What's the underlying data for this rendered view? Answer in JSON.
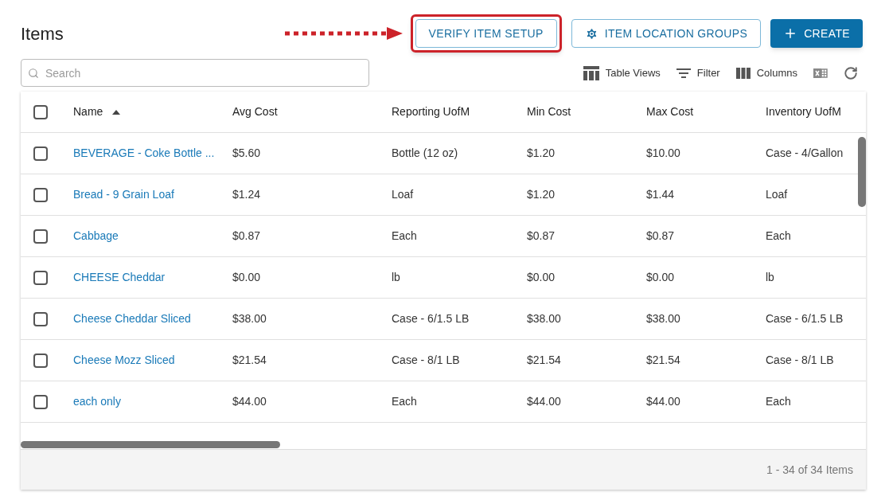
{
  "page_title": "Items",
  "header_buttons": [
    {
      "kind": "outline",
      "label": "VERIFY ITEM SETUP",
      "highlighted": true
    },
    {
      "kind": "outline-gear",
      "label": "ITEM LOCATION GROUPS",
      "highlighted": false
    },
    {
      "kind": "primary",
      "label": "CREATE",
      "highlighted": false
    }
  ],
  "search": {
    "placeholder": "Search"
  },
  "toolbar": [
    {
      "kind": "table-views",
      "label": "Table Views"
    },
    {
      "kind": "filter",
      "label": "Filter"
    },
    {
      "kind": "columns",
      "label": "Columns"
    },
    {
      "kind": "excel"
    },
    {
      "kind": "refresh"
    }
  ],
  "table": {
    "select_all": {
      "checked": false
    },
    "columns": [
      {
        "label": "Name",
        "sorted": true
      },
      {
        "label": "Avg Cost",
        "sorted": false
      },
      {
        "label": "Reporting UofM",
        "sorted": false
      },
      {
        "label": "Min Cost",
        "sorted": false
      },
      {
        "label": "Max Cost",
        "sorted": false
      },
      {
        "label": "Inventory UofM",
        "sorted": false
      }
    ],
    "rows": [
      {
        "checked": false,
        "cells": [
          "BEVERAGE - Coke Bottle ...",
          "$5.60",
          "Bottle (12 oz)",
          "$1.20",
          "$10.00",
          "Case - 4/Gallon"
        ]
      },
      {
        "checked": false,
        "cells": [
          "Bread - 9 Grain Loaf",
          "$1.24",
          "Loaf",
          "$1.20",
          "$1.44",
          "Loaf"
        ]
      },
      {
        "checked": false,
        "cells": [
          "Cabbage",
          "$0.87",
          "Each",
          "$0.87",
          "$0.87",
          "Each"
        ]
      },
      {
        "checked": false,
        "cells": [
          "CHEESE Cheddar",
          "$0.00",
          "lb",
          "$0.00",
          "$0.00",
          "lb"
        ]
      },
      {
        "checked": false,
        "cells": [
          "Cheese Cheddar Sliced",
          "$38.00",
          "Case - 6/1.5 LB",
          "$38.00",
          "$38.00",
          "Case - 6/1.5 LB"
        ]
      },
      {
        "checked": false,
        "cells": [
          "Cheese Mozz Sliced",
          "$21.54",
          "Case - 8/1 LB",
          "$21.54",
          "$21.54",
          "Case - 8/1 LB"
        ]
      },
      {
        "checked": false,
        "cells": [
          "each only",
          "$44.00",
          "Each",
          "$44.00",
          "$44.00",
          "Each"
        ]
      }
    ],
    "footer": "1 - 34 of 34 Items"
  }
}
